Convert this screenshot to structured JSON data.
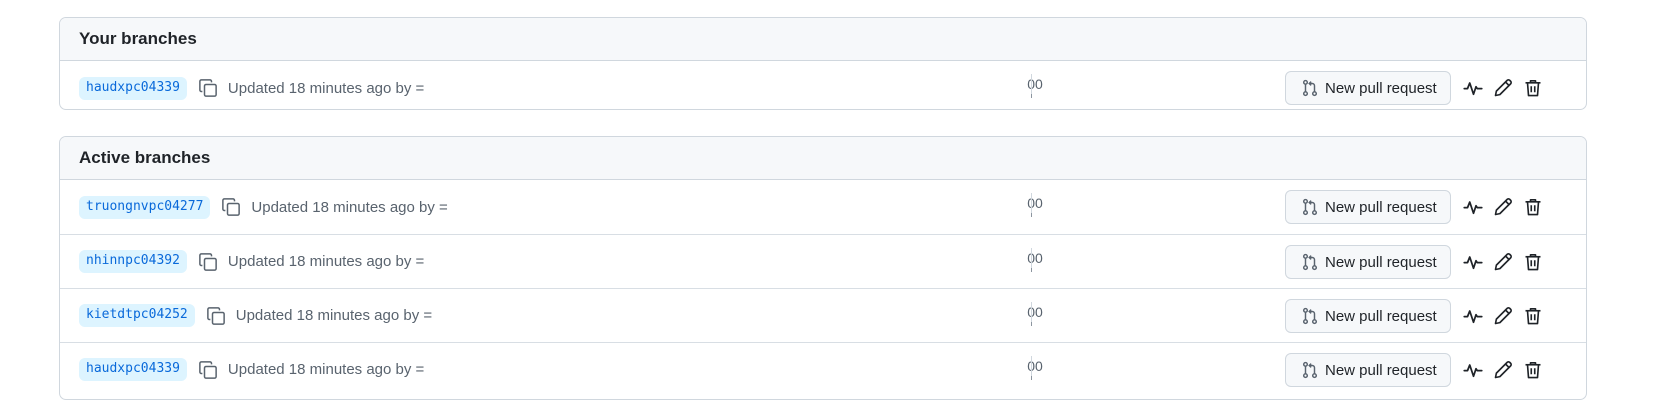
{
  "your_branches": {
    "title": "Your branches",
    "rows": [
      {
        "branch": "haudxpc04339",
        "updated": "Updated 18 minutes ago by =",
        "behind": "0",
        "ahead": "0",
        "pr_label": "New pull request"
      }
    ]
  },
  "active_branches": {
    "title": "Active branches",
    "rows": [
      {
        "branch": "truongnvpc04277",
        "updated": "Updated 18 minutes ago by =",
        "behind": "0",
        "ahead": "0",
        "pr_label": "New pull request"
      },
      {
        "branch": "nhinnpc04392",
        "updated": "Updated 18 minutes ago by =",
        "behind": "0",
        "ahead": "0",
        "pr_label": "New pull request"
      },
      {
        "branch": "kietdtpc04252",
        "updated": "Updated 18 minutes ago by =",
        "behind": "0",
        "ahead": "0",
        "pr_label": "New pull request"
      },
      {
        "branch": "haudxpc04339",
        "updated": "Updated 18 minutes ago by =",
        "behind": "0",
        "ahead": "0",
        "pr_label": "New pull request"
      }
    ]
  },
  "icons": {
    "copy": "copy-icon",
    "pull_request": "git-pull-request-icon",
    "activity": "pulse-icon",
    "rename": "pencil-icon",
    "delete": "trash-icon"
  },
  "colors": {
    "branch_text": "#0969da",
    "branch_bg": "#ddf4ff",
    "muted_text": "#59636e",
    "border": "#d0d7de",
    "header_bg": "#f6f8fa"
  }
}
